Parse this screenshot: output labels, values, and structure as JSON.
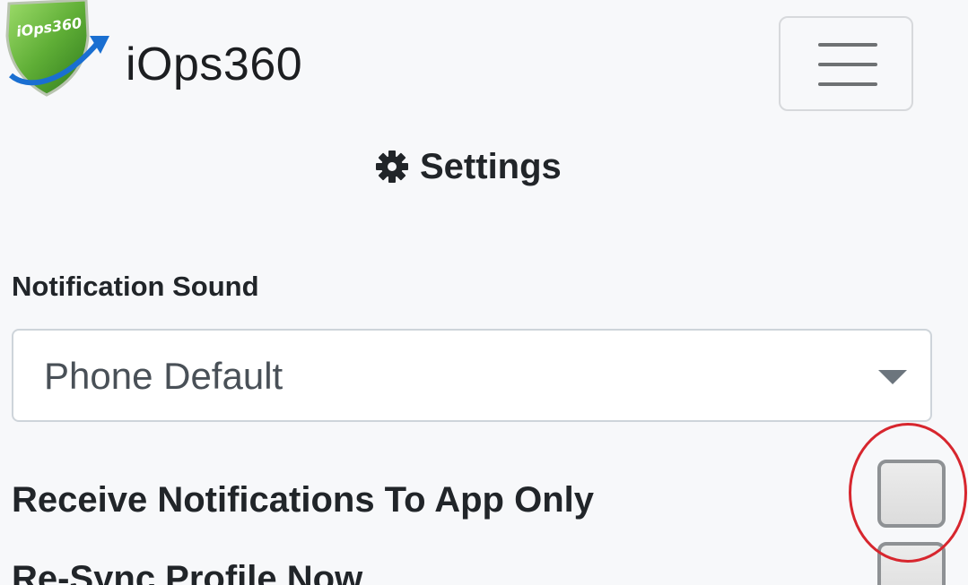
{
  "header": {
    "brand_name": "iOps360",
    "logo_text": "iOps360",
    "menu_icon": "hamburger-icon"
  },
  "settings": {
    "title": "Settings",
    "title_icon": "gear-icon"
  },
  "notification_sound": {
    "label": "Notification Sound",
    "selected_value": "Phone Default"
  },
  "options": [
    {
      "label": "Receive Notifications To App Only",
      "checked": false
    },
    {
      "label": "Re-Sync Profile Now",
      "checked": false
    }
  ],
  "colors": {
    "highlight_ring": "#d7262e",
    "logo_green": "#5fae36",
    "logo_arrow_blue": "#1a6fd1"
  }
}
